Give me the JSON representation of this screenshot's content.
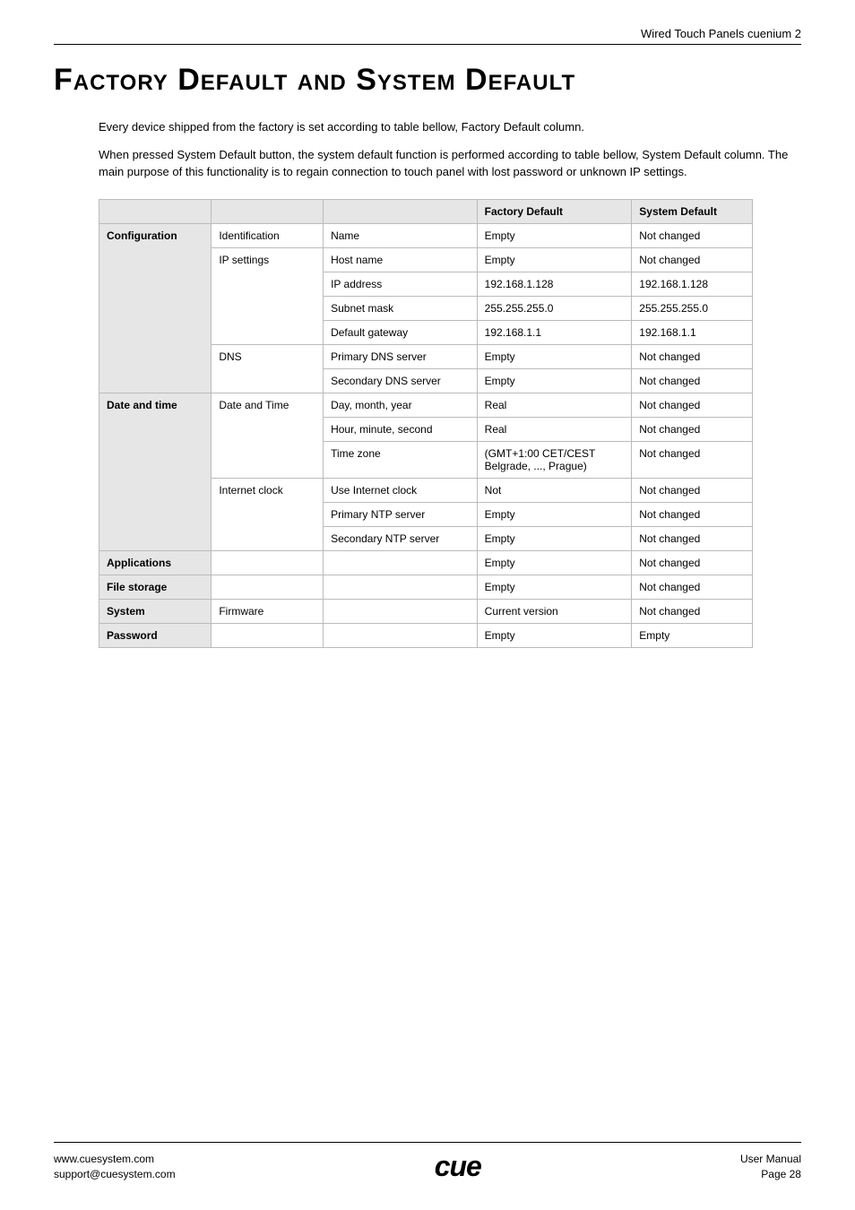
{
  "header": {
    "title": "Wired Touch Panels cuenium 2"
  },
  "title": "Factory Default and System Default",
  "paragraphs": [
    "Every device shipped from the factory is set according to table bellow, Factory Default column.",
    "When pressed System Default button, the system default function is performed according to table bellow, System Default column. The main purpose of this functionality is to regain connection to touch panel with lost password or unknown IP settings."
  ],
  "table": {
    "headers": {
      "c1": "",
      "c2": "",
      "c3": "",
      "factory": "Factory Default",
      "system": "System Default"
    },
    "rows": [
      {
        "group": "Configuration",
        "sub": "Identification",
        "item": "Name",
        "factory": "Empty",
        "system": "Not changed"
      },
      {
        "group": "",
        "sub": "IP settings",
        "item": "Host name",
        "factory": "Empty",
        "system": "Not changed"
      },
      {
        "group": "",
        "sub": "",
        "item": "IP address",
        "factory": "192.168.1.128",
        "system": "192.168.1.128"
      },
      {
        "group": "",
        "sub": "",
        "item": "Subnet mask",
        "factory": "255.255.255.0",
        "system": "255.255.255.0"
      },
      {
        "group": "",
        "sub": "",
        "item": "Default gateway",
        "factory": "192.168.1.1",
        "system": "192.168.1.1"
      },
      {
        "group": "",
        "sub": "DNS",
        "item": "Primary DNS server",
        "factory": "Empty",
        "system": "Not changed"
      },
      {
        "group": "",
        "sub": "",
        "item": "Secondary DNS server",
        "factory": "Empty",
        "system": "Not changed"
      },
      {
        "group": "Date and time",
        "sub": "Date and Time",
        "item": "Day, month, year",
        "factory": "Real",
        "system": "Not changed"
      },
      {
        "group": "",
        "sub": "",
        "item": "Hour, minute, second",
        "factory": "Real",
        "system": "Not changed"
      },
      {
        "group": "",
        "sub": "",
        "item": "Time zone",
        "factory": "(GMT+1:00 CET/CEST Belgrade, ..., Prague)",
        "system": "Not changed"
      },
      {
        "group": "",
        "sub": "Internet clock",
        "item": "Use Internet clock",
        "factory": "Not",
        "system": "Not changed"
      },
      {
        "group": "",
        "sub": "",
        "item": "Primary NTP server",
        "factory": "Empty",
        "system": "Not changed"
      },
      {
        "group": "",
        "sub": "",
        "item": "Secondary NTP server",
        "factory": "Empty",
        "system": "Not changed"
      },
      {
        "group": "Applications",
        "sub": "",
        "item": "",
        "factory": "Empty",
        "system": "Not changed"
      },
      {
        "group": "File storage",
        "sub": "",
        "item": "",
        "factory": "Empty",
        "system": "Not changed"
      },
      {
        "group": "System",
        "sub": "Firmware",
        "item": "",
        "factory": "Current version",
        "system": "Not changed"
      },
      {
        "group": "Password",
        "sub": "",
        "item": "",
        "factory": "Empty",
        "system": "Empty"
      }
    ]
  },
  "footer": {
    "left1": "www.cuesystem.com",
    "left2": "support@cuesystem.com",
    "logo": "cue",
    "right1": "User Manual",
    "right2": "Page 28"
  }
}
